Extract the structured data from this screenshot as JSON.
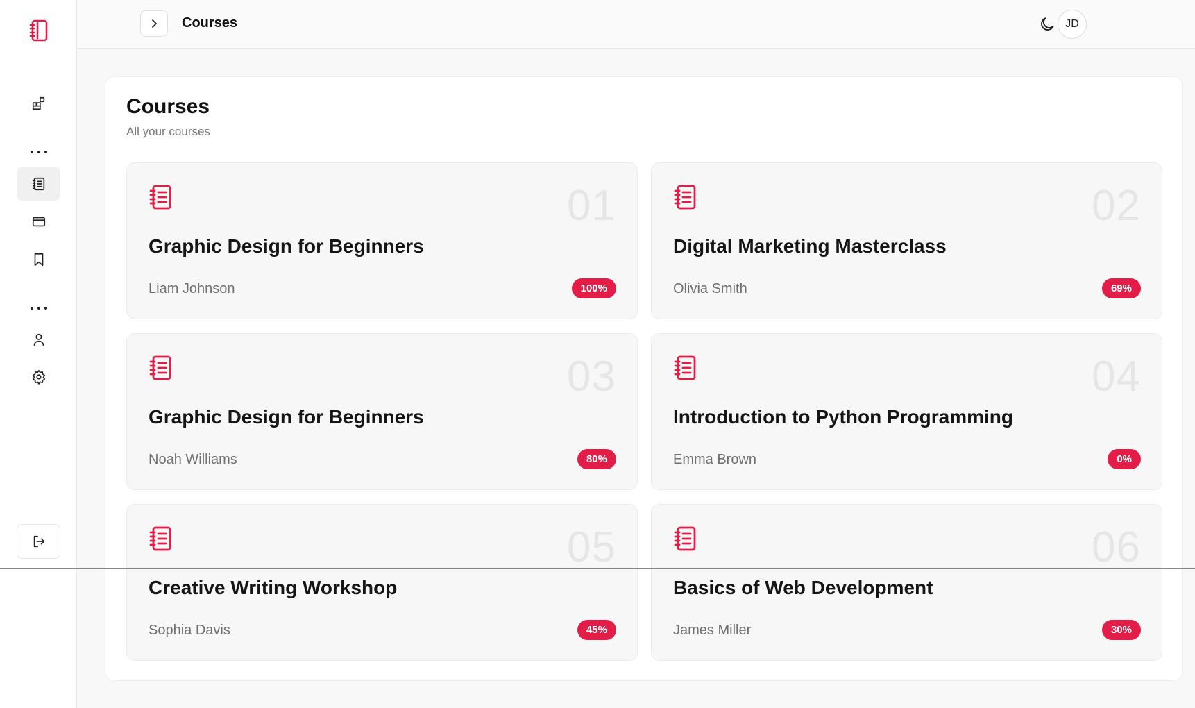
{
  "header": {
    "title": "Courses",
    "avatar_initials": "JD"
  },
  "colors": {
    "accent": "#e11d48"
  },
  "sidebar": {
    "logo_icon": "notebook-icon",
    "items": [
      {
        "name": "dashboard",
        "icon": "dashboard-icon",
        "active": false
      },
      {
        "name": "courses",
        "icon": "notebook-icon",
        "active": true
      },
      {
        "name": "payments",
        "icon": "credit-card-icon",
        "active": false
      },
      {
        "name": "bookmarks",
        "icon": "bookmark-icon",
        "active": false
      },
      {
        "name": "profile",
        "icon": "user-icon",
        "active": false
      },
      {
        "name": "settings",
        "icon": "gear-icon",
        "active": false
      }
    ],
    "logout_icon": "logout-icon"
  },
  "main": {
    "title": "Courses",
    "subtitle": "All your courses",
    "courses": [
      {
        "num": "01",
        "title": "Graphic Design for Beginners",
        "author": "Liam Johnson",
        "progress": "100%"
      },
      {
        "num": "02",
        "title": "Digital Marketing Masterclass",
        "author": "Olivia Smith",
        "progress": "69%"
      },
      {
        "num": "03",
        "title": "Graphic Design for Beginners",
        "author": "Noah Williams",
        "progress": "80%"
      },
      {
        "num": "04",
        "title": "Introduction to Python Programming",
        "author": "Emma Brown",
        "progress": "0%"
      },
      {
        "num": "05",
        "title": "Creative Writing Workshop",
        "author": "Sophia Davis",
        "progress": "45%"
      },
      {
        "num": "06",
        "title": "Basics of Web Development",
        "author": "James Miller",
        "progress": "30%"
      }
    ]
  }
}
